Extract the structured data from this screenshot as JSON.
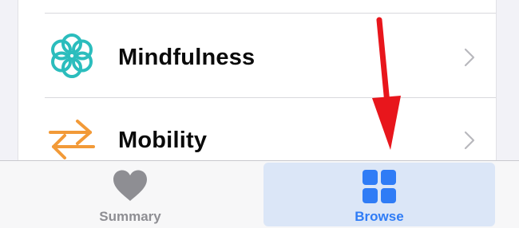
{
  "list": {
    "items": [
      {
        "label": "Mindfulness",
        "icon": "mindfulness-flower-icon",
        "icon_color": "#2bbdbd"
      },
      {
        "label": "Mobility",
        "icon": "mobility-arrows-icon",
        "icon_color": "#f29a38"
      }
    ]
  },
  "tabbar": {
    "tabs": [
      {
        "label": "Summary",
        "icon": "heart-icon",
        "selected": false
      },
      {
        "label": "Browse",
        "icon": "grid-icon",
        "selected": true
      }
    ]
  },
  "annotation": {
    "icon": "red-down-arrow-icon",
    "color": "#e8161c"
  },
  "colors": {
    "accent": "#2f7cf6",
    "inactive": "#8e8e93",
    "selected_tab_bg": "#dbe6f7"
  }
}
